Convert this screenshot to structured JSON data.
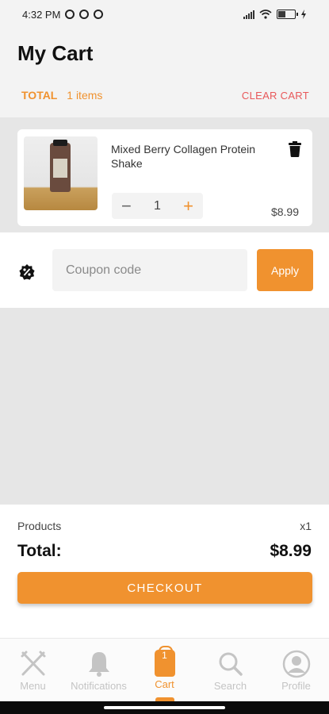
{
  "status_bar": {
    "time": "4:32 PM",
    "battery_text": "47"
  },
  "header": {
    "title": "My Cart",
    "total_label": "TOTAL",
    "items_count": "1 items",
    "clear_cart_label": "CLEAR CART"
  },
  "cart": {
    "items": [
      {
        "name": "Mixed Berry Collagen Protein Shake",
        "quantity": "1",
        "price": "$8.99",
        "quantity_minus": "−",
        "quantity_plus": "+"
      }
    ]
  },
  "coupon": {
    "placeholder": "Coupon code",
    "apply_label": "Apply",
    "icon": "discount-badge-icon"
  },
  "summary": {
    "products_label": "Products",
    "products_count": "x1",
    "total_label": "Total:",
    "total_value": "$8.99",
    "checkout_label": "CHECKOUT"
  },
  "nav": {
    "items": [
      {
        "label": "Menu",
        "icon": "utensils-icon"
      },
      {
        "label": "Notifications",
        "icon": "bell-icon"
      },
      {
        "label": "Cart",
        "icon": "cart-bag-icon",
        "badge": "1",
        "active": true
      },
      {
        "label": "Search",
        "icon": "search-icon"
      },
      {
        "label": "Profile",
        "icon": "profile-icon"
      }
    ]
  },
  "colors": {
    "accent": "#f0922f",
    "danger": "#e8585a",
    "background": "#e6e6e6"
  }
}
